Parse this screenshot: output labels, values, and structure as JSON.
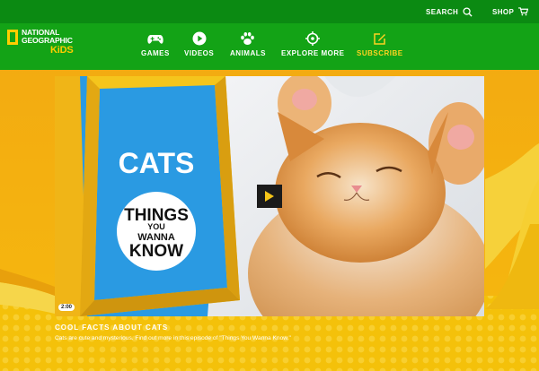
{
  "header": {
    "search_label": "SEARCH",
    "shop_label": "SHOP",
    "logo_lines": [
      "NATIONAL",
      "GEOGRAPHIC"
    ],
    "logo_kids": "KiDS",
    "nav": [
      {
        "label": "GAMES",
        "icon": "gamepad-icon"
      },
      {
        "label": "VIDEOS",
        "icon": "play-circle-icon"
      },
      {
        "label": "ANIMALS",
        "icon": "paw-icon"
      },
      {
        "label": "EXPLORE MORE",
        "icon": "compass-icon"
      },
      {
        "label": "SUBSCRIBE",
        "icon": "edit-icon"
      }
    ]
  },
  "video": {
    "title_art_word": "CATS",
    "badge_lines": [
      "THINGS",
      "YOU",
      "WANNA",
      "KNOW"
    ],
    "duration": "2:00"
  },
  "caption": {
    "title": "COOL FACTS ABOUT CATS",
    "description": "Cats are cute and mysterious. Find out more in this episode of \"Things You Wanna Know.\""
  },
  "colors": {
    "nav_green": "#13a316",
    "top_green": "#0b8a12",
    "yellow": "#f4c10a",
    "subscribe": "#ffd321"
  }
}
